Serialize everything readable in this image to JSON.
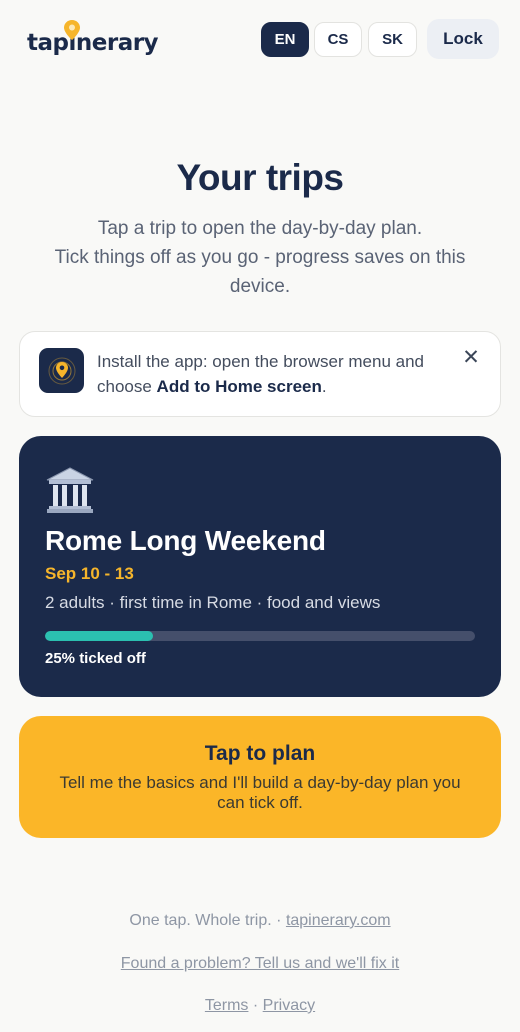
{
  "header": {
    "logo_text_before": "tap",
    "logo_text_pin_letter": "i",
    "logo_text_after": "nerary",
    "languages": [
      {
        "code": "EN",
        "active": true
      },
      {
        "code": "CS",
        "active": false
      },
      {
        "code": "SK",
        "active": false
      }
    ],
    "lock_label": "Lock",
    "brand_color": "#1b2a4a",
    "accent_color": "#fbb628"
  },
  "main": {
    "title": "Your trips",
    "subtitle_line1": "Tap a trip to open the day-by-day plan.",
    "subtitle_line2": "Tick things off as you go - progress saves on this device."
  },
  "install_banner": {
    "icon": "location-pin-icon",
    "text_before": "Install the app: open the browser menu and choose ",
    "text_bold": "Add to Home screen",
    "text_after": ".",
    "close_icon": "close-icon"
  },
  "trip": {
    "emoji": "classical-building-icon",
    "name": "Rome Long Weekend",
    "dates": "Sep 10 - 13",
    "meta": "2 adults · first time in Rome · food and views",
    "progress_fraction": 0.25,
    "progress_label": "25% ticked off",
    "progress_color": "#2bc0b0"
  },
  "plan_card": {
    "title": "Tap to plan",
    "description": "Tell me the basics and I'll build a day-by-day plan you can tick off."
  },
  "footer": {
    "tagline": "One tap. Whole trip.",
    "separator": "·",
    "site_link": "tapinerary.com",
    "report_link": "Found a problem? Tell us and we'll fix it",
    "terms_link": "Terms",
    "privacy_link": "Privacy"
  }
}
